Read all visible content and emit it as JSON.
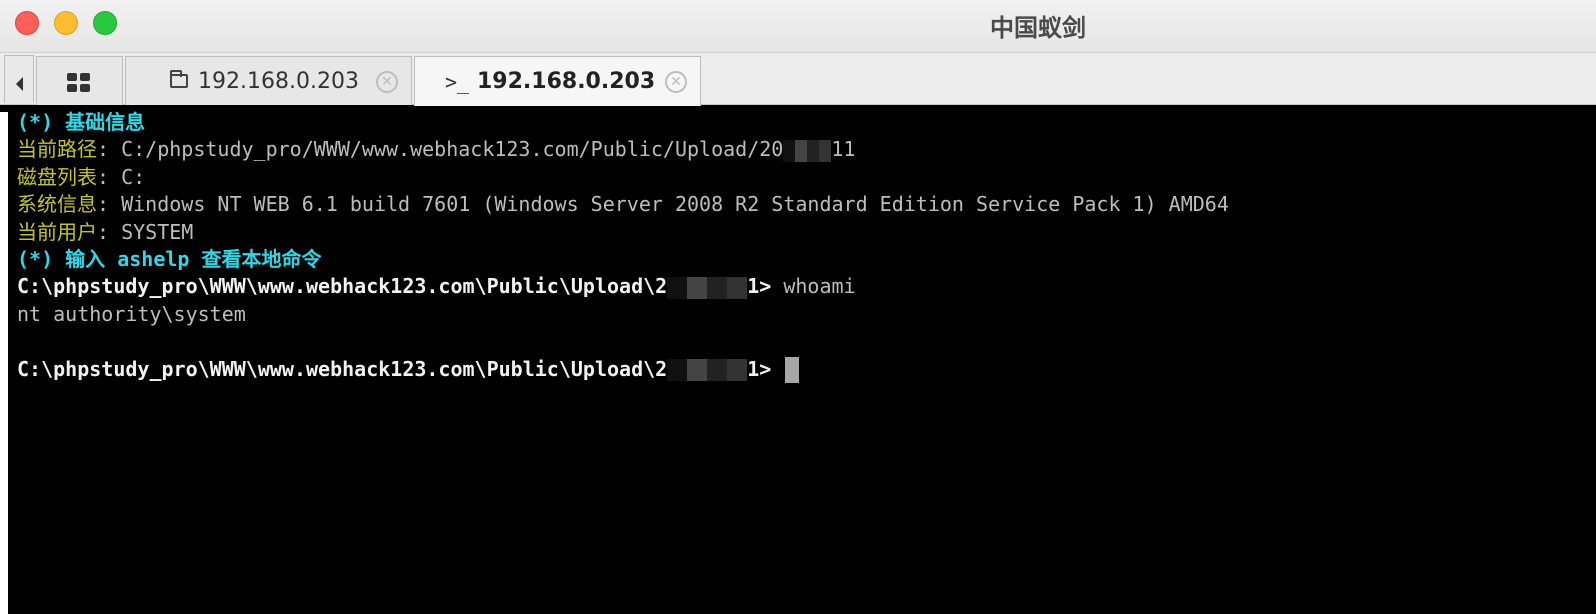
{
  "window": {
    "title": "中国蚁剑"
  },
  "tabs": [
    {
      "icon": "grid-icon",
      "label": ""
    },
    {
      "icon": "folder-icon",
      "label": "192.168.0.203"
    },
    {
      "icon": "terminal-prompt-icon",
      "label": "192.168.0.203",
      "active": true
    }
  ],
  "terminal": {
    "header_info": "(*) 基础信息",
    "path_label": "当前路径",
    "path_value": ": C:/phpstudy_pro/WWW/www.webhack123.com/Public/Upload/20",
    "path_suffix": "11",
    "disk_label": "磁盘列表",
    "disk_value": ": C:",
    "sys_label": "系统信息",
    "sys_value": ": Windows NT WEB 6.1 build 7601 (Windows Server 2008 R2 Standard Edition Service Pack 1) AMD64",
    "user_label": "当前用户",
    "user_value": ": SYSTEM",
    "help_hint": "(*) 输入 ashelp 查看本地命令",
    "prompt1": "C:\\phpstudy_pro\\WWW\\www.webhack123.com\\Public\\Upload\\2",
    "prompt1_suffix": "1>",
    "command1": " whoami",
    "output1": "nt authority\\system",
    "prompt2": "C:\\phpstudy_pro\\WWW\\www.webhack123.com\\Public\\Upload\\2",
    "prompt2_suffix": "1>"
  },
  "colors": {
    "cyan": "#2fd8e6",
    "olive": "#c4c42a",
    "terminal_bg": "#000000"
  }
}
